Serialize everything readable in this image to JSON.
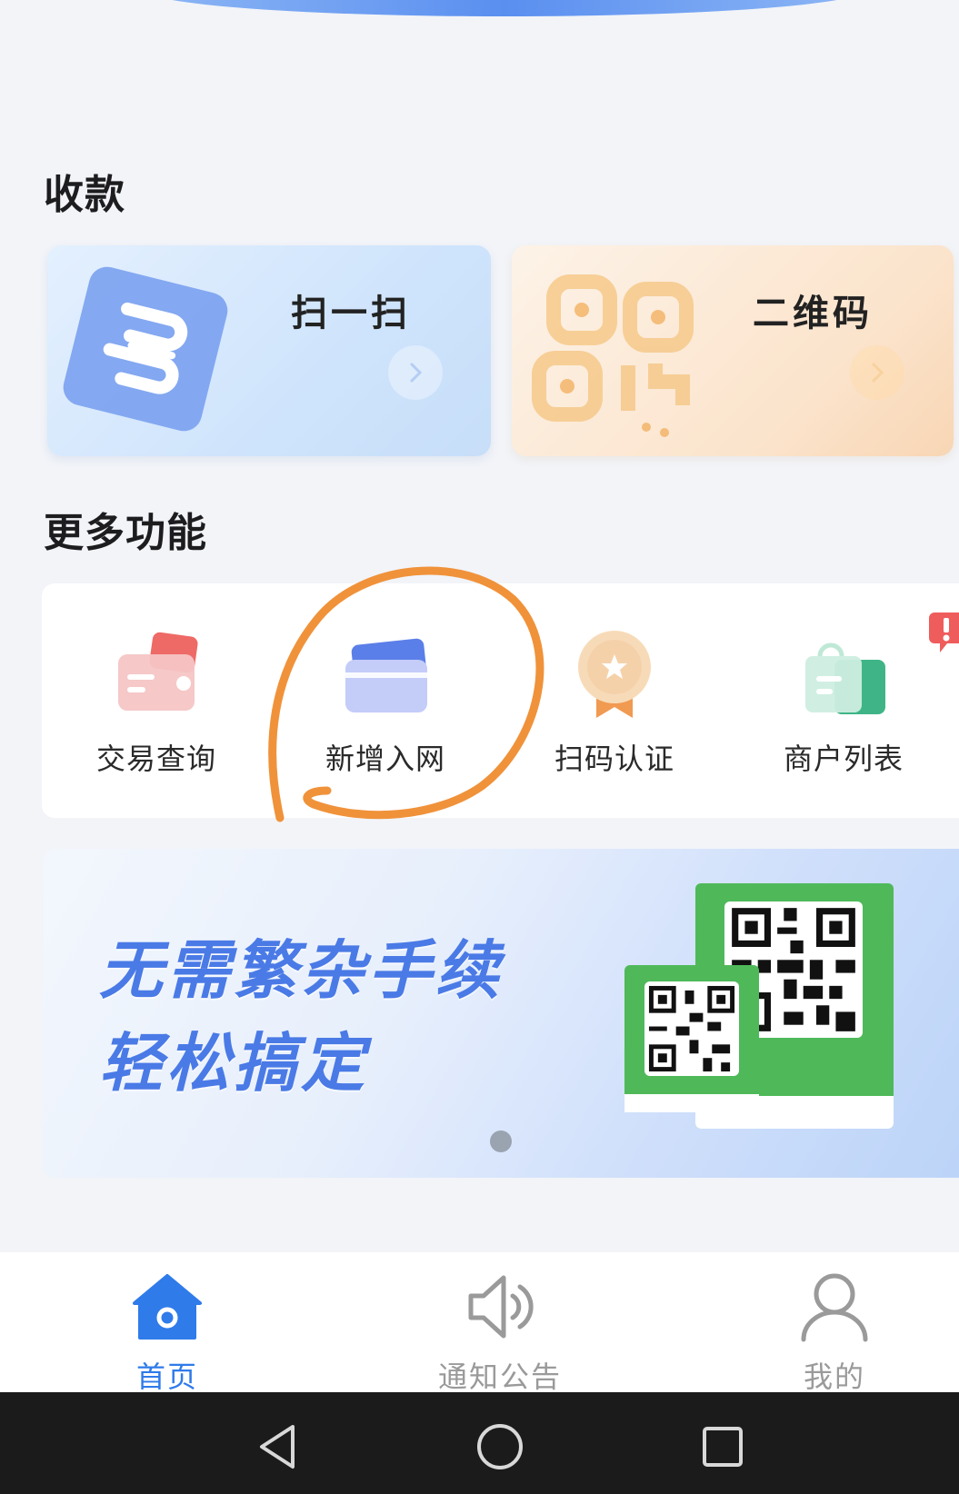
{
  "sections": {
    "collect_title": "收款",
    "more_title": "更多功能"
  },
  "cards": [
    {
      "label": "扫一扫",
      "icon": "scan-icon"
    },
    {
      "label": "二维码",
      "icon": "qr-code-icon"
    }
  ],
  "features": [
    {
      "label": "交易查询",
      "icon": "card-query-icon"
    },
    {
      "label": "新增入网",
      "icon": "bank-card-icon"
    },
    {
      "label": "扫码认证",
      "icon": "badge-medal-icon"
    },
    {
      "label": "商户列表",
      "icon": "shopping-bag-icon"
    }
  ],
  "banner": {
    "line1": "无需繁杂手续",
    "line2": "轻松搞定"
  },
  "tabbar": {
    "items": [
      {
        "label": "首页",
        "icon": "home-icon",
        "active": true
      },
      {
        "label": "通知公告",
        "icon": "speaker-icon",
        "active": false
      },
      {
        "label": "我的",
        "icon": "user-icon",
        "active": false
      }
    ]
  },
  "colors": {
    "accent": "#2f7bea",
    "banner_text": "#4a7ae6",
    "annotation": "#f0923a",
    "qr_green": "#4fb95a"
  }
}
